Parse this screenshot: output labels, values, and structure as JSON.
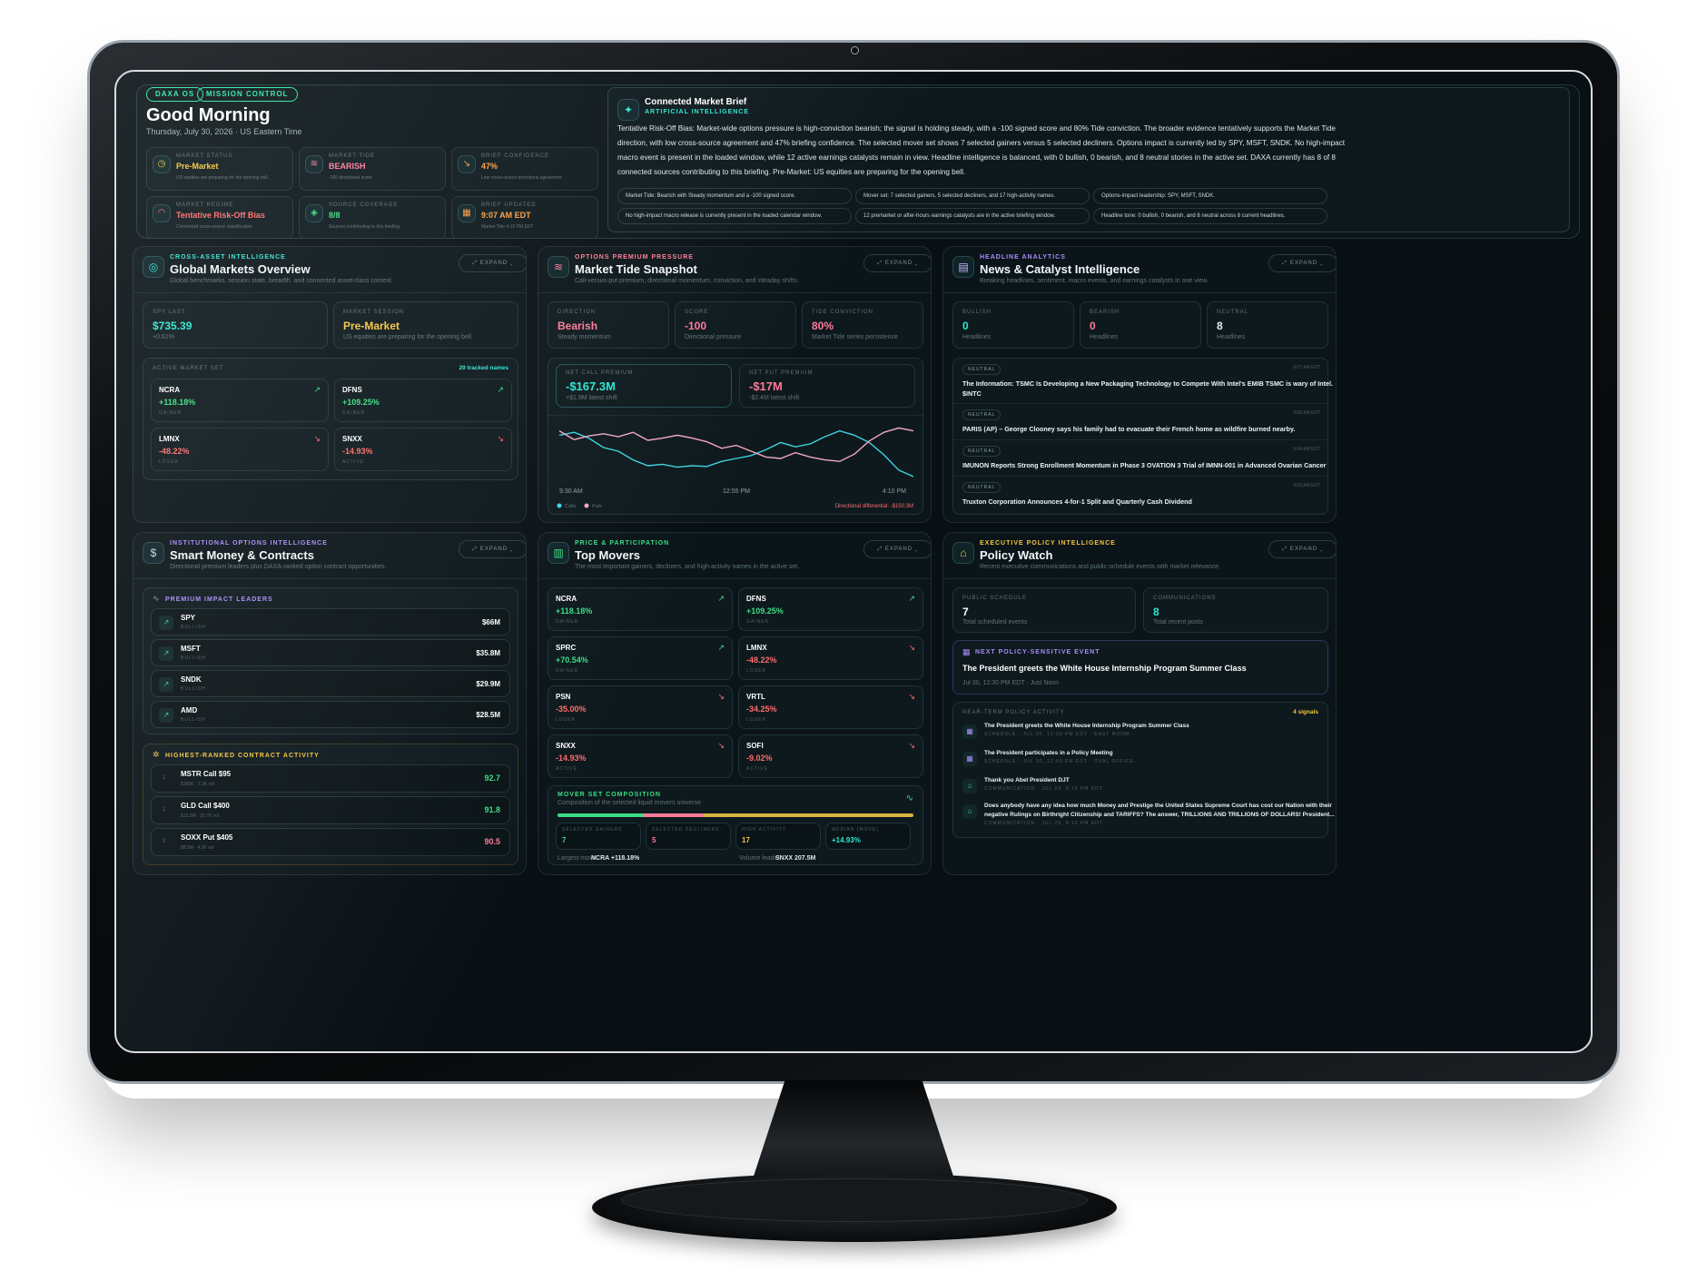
{
  "header": {
    "chips": [
      "DAXA OS",
      "MISSION CONTROL"
    ],
    "greeting": "Good Morning",
    "date": "Thursday, July 30, 2026 · US Eastern Time"
  },
  "stats": [
    {
      "label": "MARKET STATUS",
      "value": "Pre-Market",
      "sub": "US equities are preparing for the opening bell.",
      "icon": "clock-icon",
      "color": "#f5c542"
    },
    {
      "label": "MARKET TIDE",
      "value": "BEARISH",
      "sub": "-100 directional score",
      "icon": "wave-icon",
      "color": "#ff7a9a"
    },
    {
      "label": "BRIEF CONFIDENCE",
      "value": "47%",
      "sub": "Low cross-source directional agreement",
      "icon": "trend-down-icon",
      "color": "#ff9f43"
    },
    {
      "label": "MARKET REGIME",
      "value": "Tentative Risk-Off Bias",
      "sub": "Connected cross-source classification",
      "icon": "gauge-icon",
      "color": "#ff6b6b"
    },
    {
      "label": "SOURCE COVERAGE",
      "value": "8/8",
      "sub": "Sources contributing to this briefing",
      "icon": "layers-icon",
      "color": "#3ddc84"
    },
    {
      "label": "BRIEF UPDATED",
      "value": "9:07 AM EDT",
      "sub": "Market Tide 4:10 PM EDT",
      "icon": "calendar-icon",
      "color": "#ff9f43"
    }
  ],
  "brief": {
    "title": "Connected Market Brief",
    "kicker": "ARTIFICIAL INTELLIGENCE",
    "lines": [
      "Tentative Risk-Off Bias: Market-wide options pressure is high-conviction bearish; the signal is holding steady, with a -100 signed score and 80% Tide conviction. The broader evidence tentatively supports the Market Tide",
      "direction, with low cross-source agreement and 47% briefing confidence. The selected mover set shows 7 selected gainers versus 5 selected decliners. Options impact is currently led by SPY, MSFT, SNDK. No high-impact",
      "macro event is present in the loaded window, while 12 active earnings catalysts remain in view. Headline intelligence is balanced, with 0 bullish, 0 bearish, and 8 neutral stories in the active set. DAXA currently has 8 of 8",
      "connected sources contributing to this briefing. Pre-Market: US equities are preparing for the opening bell."
    ],
    "pills": [
      "Market Tide: Bearish with Steady momentum and a -100 signed score.",
      "Mover set: 7 selected gainers, 5 selected decliners, and 17 high-activity names.",
      "Options-impact leadership: SPY, MSFT, SNDK.",
      "No high-impact macro release is currently present in the loaded calendar window.",
      "12 premarket or after-hours earnings catalysts are in the active briefing window.",
      "Headline tone: 0 bullish, 0 bearish, and 8 neutral across 8 current headlines."
    ]
  },
  "expand_label": "EXPAND",
  "global": {
    "kicker": "CROSS-ASSET INTELLIGENCE",
    "title": "Global Markets Overview",
    "sub": "Global benchmarks, session state, breadth, and connected asset-class context.",
    "spy_label": "SPY LAST",
    "spy_value": "$735.39",
    "spy_sub": "+0.61%",
    "session_label": "MARKET SESSION",
    "session_value": "Pre-Market",
    "session_sub": "US equities are preparing for the opening bell.",
    "set_label": "ACTIVE MARKET SET",
    "set_count": "29 tracked names",
    "movers": [
      {
        "sym": "NCRA",
        "chg": "+118.18%",
        "tag": "GAINER",
        "up": true
      },
      {
        "sym": "DFNS",
        "chg": "+109.25%",
        "tag": "GAINER",
        "up": true
      },
      {
        "sym": "LMNX",
        "chg": "-48.22%",
        "tag": "LOSER",
        "up": false
      },
      {
        "sym": "SNXX",
        "chg": "-14.93%",
        "tag": "ACTIVE",
        "up": false
      }
    ]
  },
  "tide": {
    "kicker": "OPTIONS PREMIUM PRESSURE",
    "title": "Market Tide Snapshot",
    "sub": "Call-versus-put premium, directional momentum, conviction, and intraday shifts.",
    "boxes": [
      {
        "label": "DIRECTION",
        "value": "Bearish",
        "sub": "Steady momentum"
      },
      {
        "label": "SCORE",
        "value": "-100",
        "sub": "Directional pressure"
      },
      {
        "label": "TIDE CONVICTION",
        "value": "80%",
        "sub": "Market Tide series persistence"
      }
    ],
    "call_label": "NET CALL PREMIUM",
    "call_value": "-$167.3M",
    "call_sub": "+$1.9M latest shift",
    "put_label": "NET PUT PREMIUM",
    "put_value": "-$17M",
    "put_sub": "-$2.4M latest shift",
    "x_ticks": [
      "9:30 AM",
      "12:55 PM",
      "4:10 PM"
    ],
    "legend": [
      "Calls",
      "Puts"
    ],
    "differential": "Directional differential: -$150.3M"
  },
  "chart_data": {
    "type": "line",
    "x": [
      "9:30 AM",
      "",
      "",
      "",
      "",
      "",
      "",
      "",
      "",
      "",
      "",
      "",
      "12:55 PM",
      "",
      "",
      "",
      "",
      "",
      "",
      "",
      "",
      "",
      "",
      "",
      "4:10 PM"
    ],
    "series": [
      {
        "name": "Calls",
        "values": [
          0.62,
          0.66,
          0.58,
          0.45,
          0.4,
          0.28,
          0.2,
          0.22,
          0.18,
          0.2,
          0.19,
          0.26,
          0.3,
          0.34,
          0.42,
          0.52,
          0.46,
          0.5,
          0.6,
          0.68,
          0.62,
          0.52,
          0.35,
          0.14,
          0.05
        ]
      },
      {
        "name": "Puts",
        "values": [
          0.68,
          0.56,
          0.61,
          0.64,
          0.6,
          0.66,
          0.55,
          0.58,
          0.62,
          0.58,
          0.53,
          0.44,
          0.48,
          0.4,
          0.32,
          0.3,
          0.38,
          0.32,
          0.28,
          0.26,
          0.36,
          0.54,
          0.66,
          0.72,
          0.68
        ]
      }
    ],
    "ylim": [
      0,
      0.8
    ]
  },
  "news": {
    "kicker": "HEADLINE ANALYTICS",
    "title": "News & Catalyst Intelligence",
    "sub": "Breaking headlines, sentiment, macro events, and earnings catalysts in one view.",
    "boxes": [
      {
        "label": "BULLISH",
        "value": "0",
        "sub": "Headlines"
      },
      {
        "label": "BEARISH",
        "value": "0",
        "sub": "Headlines"
      },
      {
        "label": "NEUTRAL",
        "value": "8",
        "sub": "Headlines"
      }
    ],
    "items": [
      {
        "tag": "NEUTRAL",
        "time": "9:07 AM EDT",
        "text": "The Information: TSMC Is Developing a New Packaging Technology to Compete With Intel's EMIB TSMC is wary of Intel.",
        "text2": "$INTC"
      },
      {
        "tag": "NEUTRAL",
        "time": "9:06 AM EDT",
        "text": "PARIS (AP) – George Clooney says his family had to evacuate their French home as wildfire burned nearby.",
        "text2": ""
      },
      {
        "tag": "NEUTRAL",
        "time": "9:04 AM EDT",
        "text": "IMUNON Reports Strong Enrollment Momentum in Phase 3 OVATION 3 Trial of IMNN-001 in Advanced Ovarian Cancer",
        "text2": ""
      },
      {
        "tag": "NEUTRAL",
        "time": "9:03 AM EDT",
        "text": "Truxton Corporation Announces 4-for-1 Split and Quarterly Cash Dividend",
        "text2": ""
      }
    ]
  },
  "smart": {
    "kicker": "INSTITUTIONAL OPTIONS INTELLIGENCE",
    "title": "Smart Money & Contracts",
    "sub": "Directional premium leaders plus DAXA-ranked option contract opportunities.",
    "leaders_label": "PREMIUM IMPACT LEADERS",
    "leaders": [
      {
        "sym": "SPY",
        "tag": "BULLISH",
        "value": "$66M"
      },
      {
        "sym": "MSFT",
        "tag": "BULLISH",
        "value": "$35.8M"
      },
      {
        "sym": "SNDK",
        "tag": "BULLISH",
        "value": "$29.9M"
      },
      {
        "sym": "AMD",
        "tag": "BULLISH",
        "value": "$28.5M"
      }
    ],
    "contracts_label": "HIGHEST-RANKED CONTRACT ACTIVITY",
    "contracts": [
      {
        "rank": "1",
        "name": "MSTR Call $95",
        "sub": "$185K · 2.2K vol",
        "score": "92.7"
      },
      {
        "rank": "2",
        "name": "GLD Call $400",
        "sub": "$13.2M · 29.7K vol",
        "score": "91.8"
      },
      {
        "rank": "3",
        "name": "SOXX Put $405",
        "sub": "$8.5M · 4.3K vol",
        "score": "90.5"
      }
    ]
  },
  "top": {
    "kicker": "PRICE & PARTICIPATION",
    "title": "Top Movers",
    "sub": "The most important gainers, decliners, and high-activity names in the active set.",
    "movers": [
      {
        "sym": "NCRA",
        "chg": "+118.18%",
        "tag": "GAINER",
        "up": true
      },
      {
        "sym": "DFNS",
        "chg": "+109.25%",
        "tag": "GAINER",
        "up": true
      },
      {
        "sym": "SPRC",
        "chg": "+70.54%",
        "tag": "GAINER",
        "up": true
      },
      {
        "sym": "LMNX",
        "chg": "-48.22%",
        "tag": "LOSER",
        "up": false
      },
      {
        "sym": "PSN",
        "chg": "-35.00%",
        "tag": "LOSER",
        "up": false
      },
      {
        "sym": "VRTL",
        "chg": "-34.25%",
        "tag": "LOSER",
        "up": false
      },
      {
        "sym": "SNXX",
        "chg": "-14.93%",
        "tag": "ACTIVE",
        "up": false
      },
      {
        "sym": "SOFI",
        "chg": "-9.02%",
        "tag": "ACTIVE",
        "up": false
      }
    ],
    "comp_label": "MOVER SET COMPOSITION",
    "comp_sub": "Composition of the selected liquid movers universe",
    "comp": [
      {
        "label": "SELECTED GAINERS",
        "value": "7"
      },
      {
        "label": "SELECTED DECLINERS",
        "value": "5"
      },
      {
        "label": "HIGH ACTIVITY",
        "value": "17"
      },
      {
        "label": "MEDIAN (MOVE)",
        "value": "+14.93%"
      }
    ],
    "composition_shares": {
      "gainers": 0.24,
      "decliners": 0.17,
      "high_activity": 0.59
    },
    "largest_label": "Largest move:",
    "largest_value": "NCRA +118.18%",
    "volume_label": "Volume leader:",
    "volume_value": "SNXX 207.5M"
  },
  "policy": {
    "kicker": "EXECUTIVE POLICY INTELLIGENCE",
    "title": "Policy Watch",
    "sub": "Recent executive communications and public-schedule events with market relevance.",
    "sched_label": "PUBLIC SCHEDULE",
    "sched_value": "7",
    "sched_sub": "Total scheduled events",
    "comm_label": "COMMUNICATIONS",
    "comm_value": "8",
    "comm_sub": "Total recent posts",
    "next_label": "NEXT POLICY-SENSITIVE EVENT",
    "next_title": "The President greets the White House Internship Program Summer Class",
    "next_sub": "Jul 30, 12:30 PM EDT · Just Noon",
    "near_label": "NEAR-TERM POLICY ACTIVITY",
    "near_count": "4 signals",
    "activity": [
      {
        "title": "The President greets the White House Internship Program Summer Class",
        "title2": "",
        "sub": "SCHEDULE · JUL 30, 12:30 PM EDT · EAST ROOM"
      },
      {
        "title": "The President participates in a Policy Meeting",
        "title2": "",
        "sub": "SCHEDULE · JUL 30, 12:00 PM EDT · OVAL OFFICE"
      },
      {
        "title": "Thank you Abel President DJT",
        "title2": "",
        "sub": "COMMUNICATION · JUL 29, 9:15 PM EDT"
      },
      {
        "title": "Does anybody have any idea how much Money and Prestige the United States Supreme Court has cost our Nation with their",
        "title2": "negative Rulings on Birthright Citizenship and TARIFFS? The answer, TRILLIONS AND TRILLIONS OF DOLLARS! President...",
        "sub": "COMMUNICATION · JUL 29, 8:15 PM EDT"
      }
    ]
  },
  "colors": {
    "accent": "#2ee6d1",
    "green": "#3ddc84",
    "red": "#ff6b6b",
    "calls": "#3fd3e0",
    "puts": "#f2a7c3"
  }
}
